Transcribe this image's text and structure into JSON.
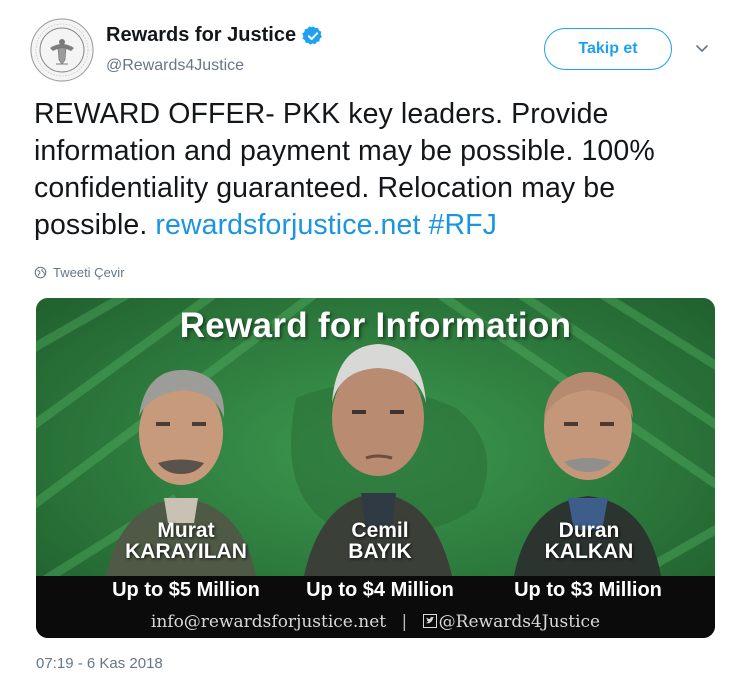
{
  "account": {
    "name": "Rewards for Justice",
    "handle": "@Rewards4Justice",
    "verified": true,
    "avatar_icon": "state-department-seal-icon"
  },
  "header": {
    "follow_label": "Takip et",
    "more_icon": "chevron-down-icon"
  },
  "tweet": {
    "text": "REWARD OFFER- PKK key leaders. Provide information and payment may be possible. 100% confidentiality guaranteed. Relocation may be possible.",
    "link": "rewardsforjustice.net",
    "hashtag": "#RFJ",
    "translate_label": "Tweeti Çevir",
    "timestamp": "07:19 - 6 Kas 2018"
  },
  "media": {
    "title": "Reward for Information",
    "people": [
      {
        "first": "Murat",
        "last": "KARAYILAN",
        "reward": "Up to $5 Million"
      },
      {
        "first": "Cemil",
        "last": "BAYIK",
        "reward": "Up to $4 Million"
      },
      {
        "first": "Duran",
        "last": "KALKAN",
        "reward": "Up to $3 Million"
      }
    ],
    "email": "info@rewardsforjustice.net",
    "separator": "|",
    "twitter_handle": "@Rewards4Justice"
  },
  "colors": {
    "accent": "#1da1f2",
    "link": "#1b95e0",
    "muted": "#657786",
    "media_green": "#2c7a3e",
    "band": "#0b0b0b"
  }
}
